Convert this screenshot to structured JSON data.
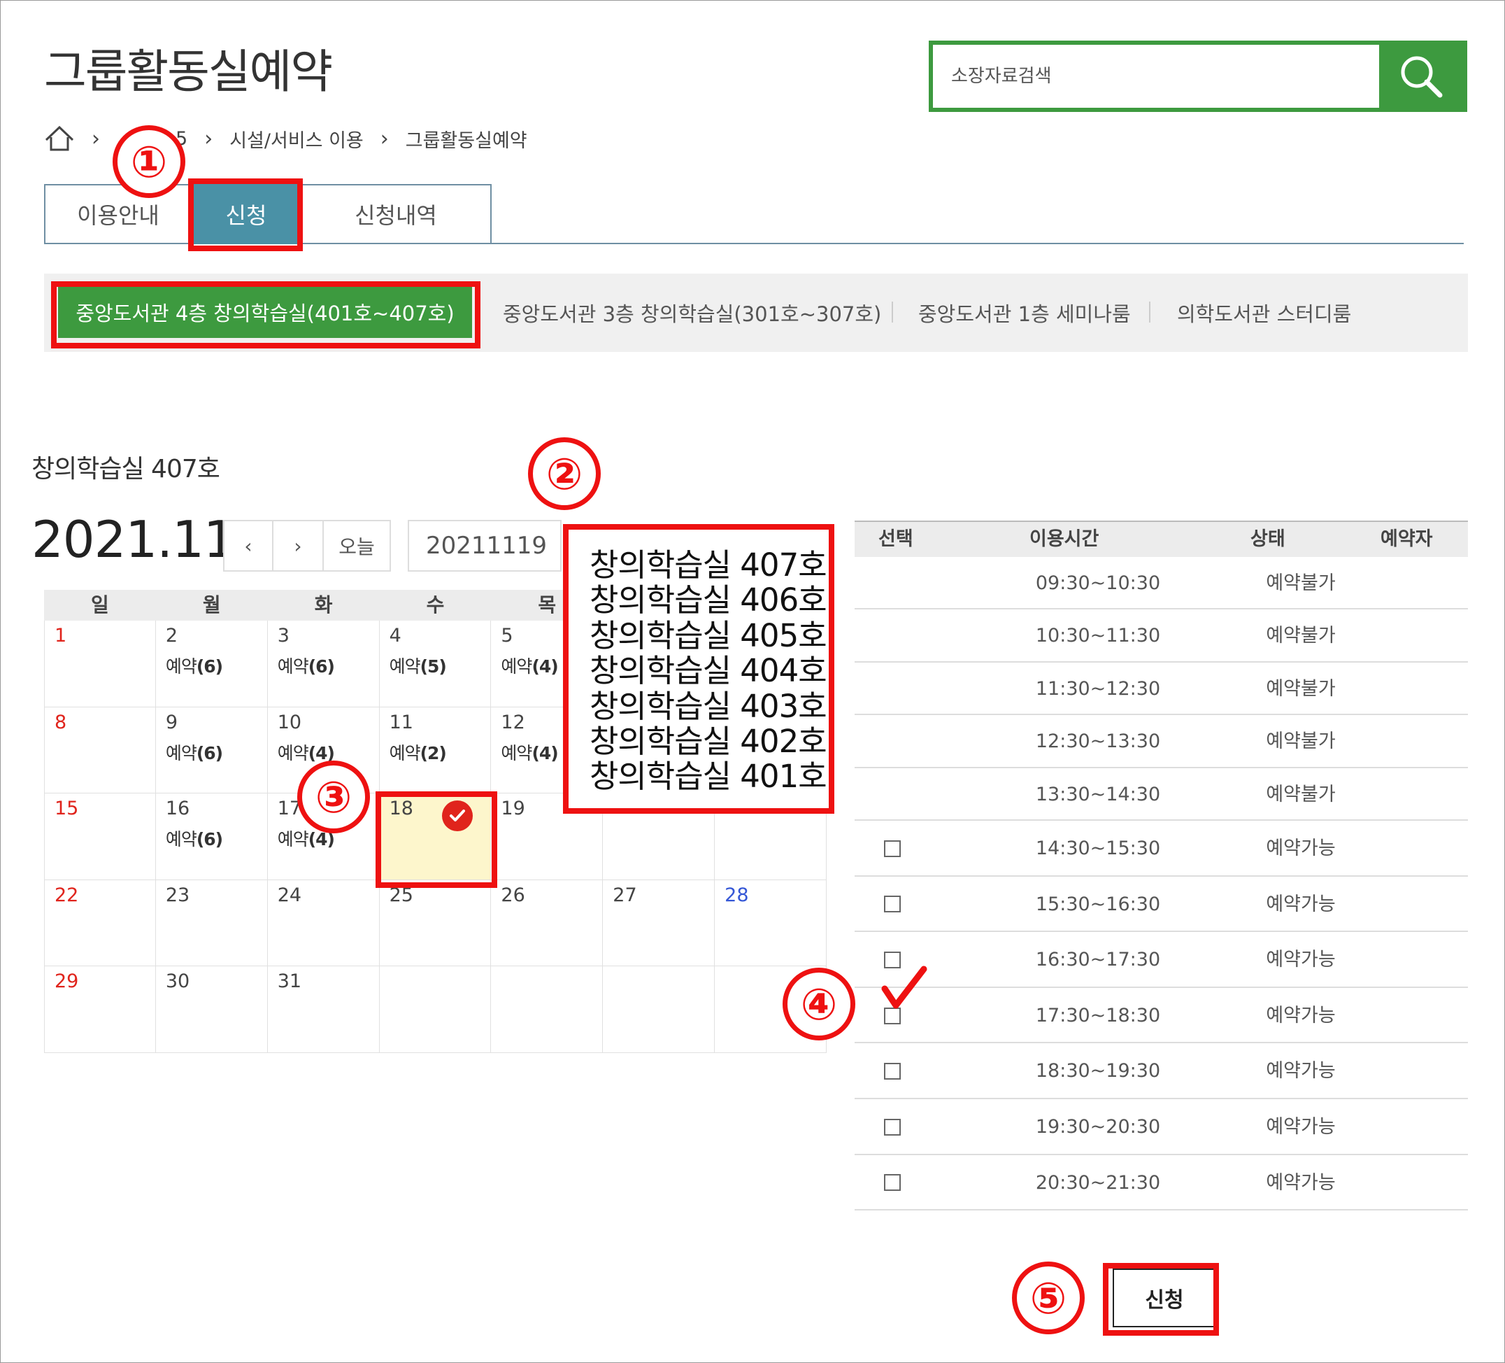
{
  "header": {
    "title": "그룹활동실예약",
    "search_placeholder": "소장자료검색"
  },
  "breadcrumb": {
    "items": [
      "5",
      "시설/서비스 이용",
      "그룹활동실예약"
    ]
  },
  "tabs": [
    {
      "label": "이용안내"
    },
    {
      "label": "신청"
    },
    {
      "label": "신청내역"
    }
  ],
  "buildings": [
    {
      "label": "중앙도서관 4층 창의학습실(401호~407호)"
    },
    {
      "label": "중앙도서관 3층 창의학습실(301호~307호)"
    },
    {
      "label": "중앙도서관 1층 세미나룸"
    },
    {
      "label": "의학도서관 스터디룸"
    }
  ],
  "room_title": "창의학습실 407호",
  "calendar": {
    "month_label": "2021.11",
    "today_label": "오늘",
    "date_value": "20211119",
    "weekdays": [
      "일",
      "월",
      "화",
      "수",
      "목"
    ],
    "cells": [
      {
        "day": "1"
      },
      {
        "day": "2",
        "res": "예약",
        "count": "(6)"
      },
      {
        "day": "3",
        "res": "예약",
        "count": "(6)"
      },
      {
        "day": "4",
        "res": "예약",
        "count": "(5)"
      },
      {
        "day": "5",
        "res": "예약",
        "count": "(4)"
      },
      {
        "day": "8"
      },
      {
        "day": "9",
        "res": "예약",
        "count": "(6)"
      },
      {
        "day": "10",
        "res": "예약",
        "count": "(4)"
      },
      {
        "day": "11",
        "res": "예약",
        "count": "(2)"
      },
      {
        "day": "12",
        "res": "예약",
        "count": "(4)"
      },
      {
        "day": "15"
      },
      {
        "day": "16",
        "res": "예약",
        "count": "(6)"
      },
      {
        "day": "17",
        "res": "예약",
        "count": "(4)"
      },
      {
        "day": "18"
      },
      {
        "day": "19"
      },
      {
        "day": "22"
      },
      {
        "day": "23"
      },
      {
        "day": "24"
      },
      {
        "day": "25"
      },
      {
        "day": "26"
      },
      {
        "day": "27"
      },
      {
        "day": "28"
      },
      {
        "day": "29"
      },
      {
        "day": "30"
      },
      {
        "day": "31"
      }
    ],
    "selected_day": "18"
  },
  "room_list": [
    "창의학습실 407호",
    "창의학습실 406호",
    "창의학습실 405호",
    "창의학습실 404호",
    "창의학습실 403호",
    "창의학습실 402호",
    "창의학습실 401호"
  ],
  "time_table": {
    "headers": [
      "선택",
      "이용시간",
      "상태",
      "예약자"
    ],
    "rows": [
      {
        "time": "09:30~10:30",
        "status": "예약불가"
      },
      {
        "time": "10:30~11:30",
        "status": "예약불가"
      },
      {
        "time": "11:30~12:30",
        "status": "예약불가"
      },
      {
        "time": "12:30~13:30",
        "status": "예약불가"
      },
      {
        "time": "13:30~14:30",
        "status": "예약불가"
      },
      {
        "time": "14:30~15:30",
        "status": "예약가능"
      },
      {
        "time": "15:30~16:30",
        "status": "예약가능"
      },
      {
        "time": "16:30~17:30",
        "status": "예약가능"
      },
      {
        "time": "17:30~18:30",
        "status": "예약가능",
        "checked": true
      },
      {
        "time": "18:30~19:30",
        "status": "예약가능"
      },
      {
        "time": "19:30~20:30",
        "status": "예약가능"
      },
      {
        "time": "20:30~21:30",
        "status": "예약가능"
      }
    ]
  },
  "apply_button": "신청",
  "step_markers": [
    "①",
    "②",
    "③",
    "④",
    "⑤"
  ],
  "colors": {
    "brand_green": "#3d9a3f",
    "tab_active": "#4a91a6",
    "annotation_red": "#ee1111",
    "selected_day_bg": "#fdf6cc",
    "sunday": "#e0241c",
    "saturday": "#3557d6"
  }
}
